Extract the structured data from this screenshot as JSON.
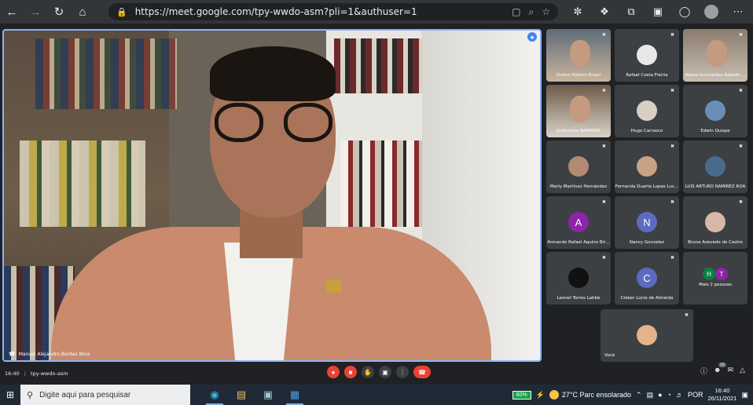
{
  "browser": {
    "url": "https://meet.google.com/tpy-wwdo-asm?pli=1&authuser=1"
  },
  "meeting": {
    "time": "16:40",
    "code": "tpy-wwdo-asm",
    "main_speaker": "Manuel Alejandro Bordas Nina",
    "participants_count": "19"
  },
  "tiles": [
    {
      "name": "Doiton Ribeiro Brasil",
      "type": "video"
    },
    {
      "name": "Rafael Costa Freiria",
      "type": "avatar",
      "color": "#e8e8e8"
    },
    {
      "name": "Wania Guimarães Rabello ...",
      "type": "video"
    },
    {
      "name": "Guilherme BARRERA",
      "type": "video"
    },
    {
      "name": "Hugo Carrasco",
      "type": "avatar",
      "color": "#d8cfc2"
    },
    {
      "name": "Edwin Quispe",
      "type": "avatar",
      "color": "#6a8fb5"
    },
    {
      "name": "Merly Martínez Hernández",
      "type": "avatar",
      "color": "#b48a72"
    },
    {
      "name": "Fernanda Duarte Lopes Luc...",
      "type": "avatar",
      "color": "#c9a285"
    },
    {
      "name": "LUIS ARTURO RAMIREZ ROA",
      "type": "avatar",
      "color": "#4a6a8f"
    },
    {
      "name": "Armando Rafael Aquino Bri...",
      "type": "letter",
      "letter": "A",
      "color": "#8e24aa"
    },
    {
      "name": "Nancy Gonzalez",
      "type": "letter",
      "letter": "N",
      "color": "#5c6bc0"
    },
    {
      "name": "Bruna Azevedo de Castro",
      "type": "avatar",
      "color": "#d7b8a6"
    },
    {
      "name": "Leonel Torres Labbé",
      "type": "avatar",
      "color": "#111111"
    },
    {
      "name": "Cleber Lúcio de Almeida",
      "type": "letter",
      "letter": "C",
      "color": "#5c6bc0"
    },
    {
      "name": "Mais 2 pessoas",
      "type": "more",
      "letters": [
        "H",
        "T"
      ],
      "colors": [
        "#0b8043",
        "#8e24aa"
      ]
    },
    {
      "name": "Você",
      "type": "avatar",
      "color": "#e3b38a"
    }
  ],
  "taskbar": {
    "search_placeholder": "Digite aqui para pesquisar",
    "battery": "60%",
    "weather": "27°C  Parc ensolarado",
    "lang": "POR",
    "time": "16:40",
    "date": "26/11/2021"
  }
}
